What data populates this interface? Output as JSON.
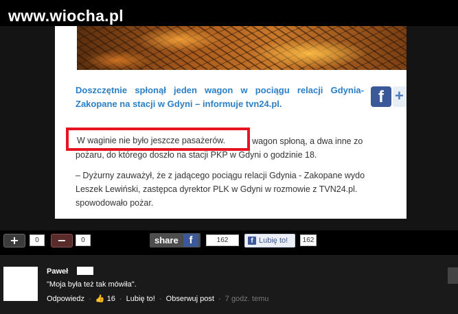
{
  "site": {
    "watermark": "www.wiocha.pl"
  },
  "article": {
    "headline": "Doszczętnie spłonął jeden wagon w pociągu relacji Gdynia-Zakopane na stacji w Gdyni – informuje tvn24.pl.",
    "highlight": "W waginie nie było jeszcze pasażerów.",
    "p1_rest": " Jeden wagon spłoną, a dwa inne zo",
    "p2": "pożaru, do którego doszło na stacji PKP w Gdyni o godzinie 18.",
    "p3": "– Dyżurny zauważył, że z jadącego pociągu relacji Gdynia - Zakopane wydo",
    "p4": "Leszek Lewiński, zastępca dyrektor PLK w Gdyni w rozmowie z TVN24.pl.",
    "p5": "spowodowało pożar.",
    "share_icons": [
      "facebook-icon",
      "plus-icon"
    ]
  },
  "actions": {
    "upvotes": "0",
    "downvotes": "0",
    "share_label": "share",
    "share_count": "162",
    "like_label": "Lubię to!",
    "like_count": "162"
  },
  "comment": {
    "author": "Paweł",
    "text": "\"Moja była też tak mówiła\".",
    "reply": "Odpowiedz",
    "likes": "16",
    "like": "Lubię to!",
    "follow": "Obserwuj post",
    "time": "7 godz. temu"
  },
  "colors": {
    "accent_blue": "#2b7fc7",
    "highlight_red": "#e6141e",
    "facebook": "#3b5998"
  }
}
